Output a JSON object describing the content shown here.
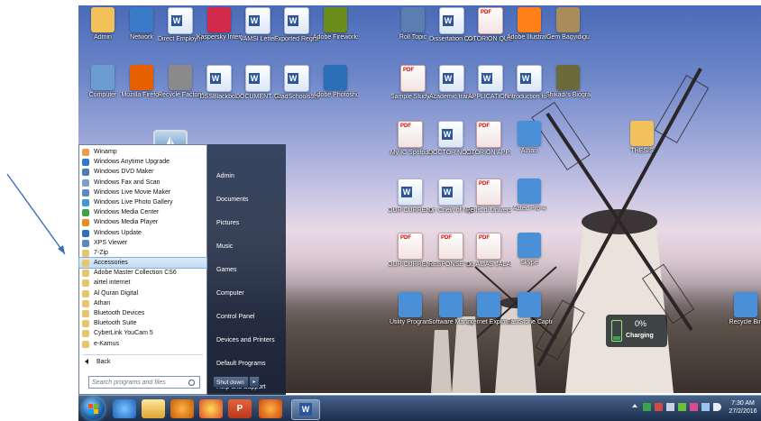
{
  "desktop": {
    "icons": [
      {
        "label": "Admin",
        "kind": "folder",
        "color": "#f2c15a"
      },
      {
        "label": "Network",
        "kind": "app",
        "color": "#3a7bc8"
      },
      {
        "label": "Direct Employm...",
        "kind": "word",
        "color": "#2b579a"
      },
      {
        "label": "Kaspersky Internet...",
        "kind": "app",
        "color": "#d12a4a"
      },
      {
        "label": "VAMSI Letter",
        "kind": "word",
        "color": "#2b579a"
      },
      {
        "label": "Exported Registrati...",
        "kind": "word",
        "color": "#2b579a"
      },
      {
        "label": "Adobe Fireworks...",
        "kind": "app",
        "color": "#6b8c1a"
      },
      {
        "label": "",
        "kind": "gap",
        "color": ""
      },
      {
        "label": "Roll Topic",
        "kind": "app",
        "color": "#5b7db0"
      },
      {
        "label": "Dissertation Overview",
        "kind": "word",
        "color": "#2b579a"
      },
      {
        "label": "OTORION QUESTIONS",
        "kind": "pdf",
        "color": "#c00000"
      },
      {
        "label": "Adobe Illustrat...",
        "kind": "app",
        "color": "#ff7f18"
      },
      {
        "label": "Gem Bagyidigu",
        "kind": "app",
        "color": "#aa8b5a"
      },
      {
        "label": "Computer",
        "kind": "app",
        "color": "#6a9bd1"
      },
      {
        "label": "Mozilla Firefox",
        "kind": "app",
        "color": "#e66000"
      },
      {
        "label": "Recycle Factory",
        "kind": "app",
        "color": "#8a8a8a"
      },
      {
        "label": "DSSBlackbox",
        "kind": "word",
        "color": "#2b579a"
      },
      {
        "label": "DOCUMENT TO WRITE...",
        "kind": "word",
        "color": "#2b579a"
      },
      {
        "label": "GradSchoolsSnc",
        "kind": "word",
        "color": "#2b579a"
      },
      {
        "label": "Adobe Photoshop...",
        "kind": "app",
        "color": "#2a6fb8"
      },
      {
        "label": "",
        "kind": "gap",
        "color": ""
      },
      {
        "label": "Sample Study Concept",
        "kind": "pdf",
        "color": "#c00000"
      },
      {
        "label": "Academic transcript...",
        "kind": "word",
        "color": "#2b579a"
      },
      {
        "label": "APPLICATIONS...",
        "kind": "word",
        "color": "#2b579a"
      },
      {
        "label": "Introduction to thesis...",
        "kind": "word",
        "color": "#2b579a"
      },
      {
        "label": "Shikadi's Biography...",
        "kind": "app",
        "color": "#6b6b3a"
      }
    ],
    "right_icons": [
      {
        "label": "My IC Spotpdf",
        "kind": "pdf"
      },
      {
        "label": "DOCTOR NOTE ON...",
        "kind": "word"
      },
      {
        "label": "OTORION APPROV.pdf",
        "kind": "pdf"
      },
      {
        "label": "Athan",
        "kind": "app"
      },
      {
        "label": "THESIS",
        "kind": "folder"
      },
      {
        "label": "OUR CURRENT...",
        "kind": "word"
      },
      {
        "label": "Dr. Chew of Nijed Sci...",
        "kind": "word"
      },
      {
        "label": "Perlis di University...",
        "kind": "pdf"
      },
      {
        "label": "Aztec Pro-4",
        "kind": "app"
      },
      {
        "label": "OUR CURRENT...",
        "kind": "pdf"
      },
      {
        "label": "RESPONSE TO FINES OF...",
        "kind": "pdf"
      },
      {
        "label": "Dr. ALIAS JALAL",
        "kind": "pdf"
      },
      {
        "label": "Skype",
        "kind": "app"
      },
      {
        "label": "Utility Program",
        "kind": "app"
      },
      {
        "label": "Software Manager",
        "kind": "app"
      },
      {
        "label": "Internet Explorer",
        "kind": "app"
      },
      {
        "label": "FastStone Capture",
        "kind": "app"
      },
      {
        "label": "Recycle Bin",
        "kind": "app"
      }
    ]
  },
  "start_menu": {
    "programs": [
      {
        "label": "Winamp",
        "color": "#e8a14a"
      },
      {
        "label": "Windows Anytime Upgrade",
        "color": "#2f7ad0"
      },
      {
        "label": "Windows DVD Maker",
        "color": "#4a7fb5"
      },
      {
        "label": "Windows Fax and Scan",
        "color": "#7aa0c8"
      },
      {
        "label": "Windows Live Movie Maker",
        "color": "#5b89c4"
      },
      {
        "label": "Windows Live Photo Gallery",
        "color": "#3d9ad6"
      },
      {
        "label": "Windows Media Center",
        "color": "#3aa34b"
      },
      {
        "label": "Windows Media Player",
        "color": "#f08a1c"
      },
      {
        "label": "Windows Update",
        "color": "#2d6fc0"
      },
      {
        "label": "XPS Viewer",
        "color": "#5a8ac0"
      },
      {
        "label": "7-Zip",
        "color": "#e8c56a"
      },
      {
        "label": "Accessories",
        "color": "#e8c56a",
        "selected": true
      },
      {
        "label": "Adobe Master Collection CS6",
        "color": "#e8c56a"
      },
      {
        "label": "airtel internet",
        "color": "#e8c56a"
      },
      {
        "label": "Al Quran Digital",
        "color": "#e8c56a"
      },
      {
        "label": "Athan",
        "color": "#e8c56a"
      },
      {
        "label": "Bluetooth Devices",
        "color": "#e8c56a"
      },
      {
        "label": "Bluetooth Suite",
        "color": "#e8c56a"
      },
      {
        "label": "CyberLink YouCam 5",
        "color": "#e8c56a"
      },
      {
        "label": "e-Kamus",
        "color": "#e8c56a"
      }
    ],
    "back_label": "Back",
    "search_placeholder": "Search programs and files",
    "right_links": [
      "Admin",
      "Documents",
      "Pictures",
      "Music",
      "Games",
      "Computer",
      "Control Panel",
      "Devices and Printers",
      "Default Programs",
      "Help and Support"
    ],
    "shutdown_label": "Shut down"
  },
  "battery": {
    "percent": "0%",
    "status": "Charging"
  },
  "taskbar": {
    "time": "7:30 AM",
    "date": "27/2/2016",
    "pinned": [
      "start-orb",
      "internet-explorer",
      "windows-explorer",
      "media-player",
      "chrome",
      "powerpoint",
      "firefox",
      "word"
    ]
  }
}
